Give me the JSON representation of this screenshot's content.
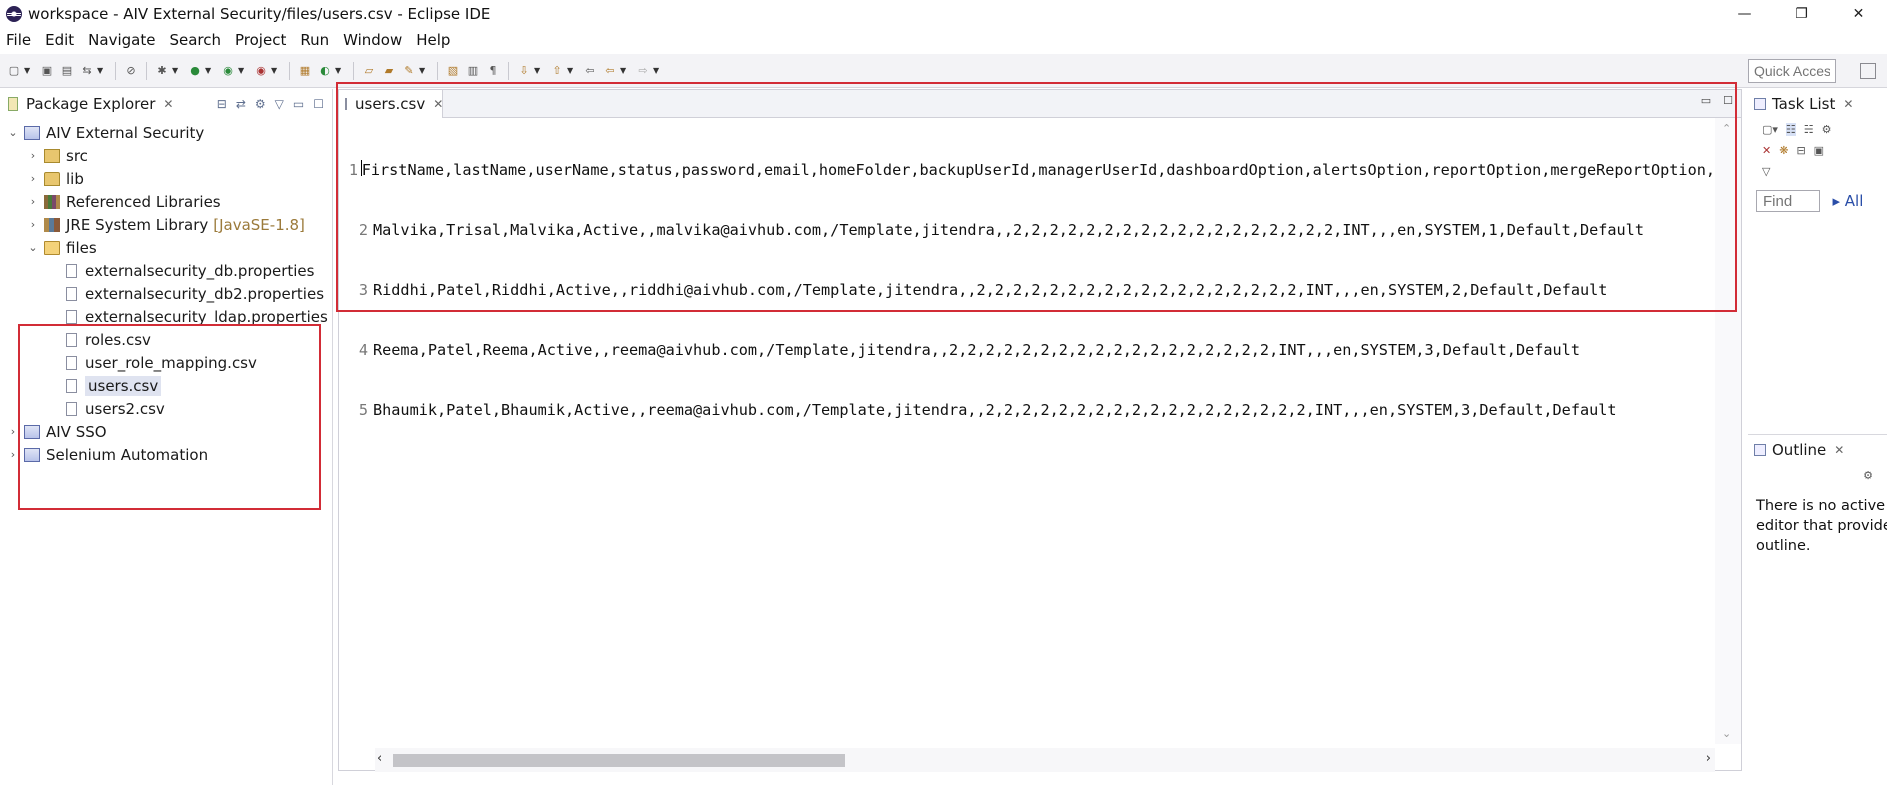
{
  "window": {
    "title": "workspace - AIV External Security/files/users.csv - Eclipse IDE",
    "minimize": "—",
    "restore": "❐",
    "close": "✕"
  },
  "menu": [
    "File",
    "Edit",
    "Navigate",
    "Search",
    "Project",
    "Run",
    "Window",
    "Help"
  ],
  "toolbar": {
    "quick_access_placeholder": "Quick Access"
  },
  "package_explorer": {
    "title": "Package Explorer",
    "tree": {
      "project": "AIV External Security",
      "src": "src",
      "lib": "lib",
      "ref_libs": "Referenced Libraries",
      "jre": "JRE System Library",
      "jre_version": "[JavaSE-1.8]",
      "files": "files",
      "file_items": [
        "externalsecurity_db.properties",
        "externalsecurity_db2.properties",
        "externalsecurity_ldap.properties",
        "roles.csv",
        "user_role_mapping.csv",
        "users.csv",
        "users2.csv"
      ],
      "project2": "AIV SSO",
      "project3": "Selenium Automation"
    }
  },
  "editor": {
    "tab_label": "users.csv",
    "lines": [
      {
        "num": "1",
        "text": "FirstName,lastName,userName,status,password,email,homeFolder,backupUserId,managerUserId,dashboardOption,alertsOption,reportOption,mergeReportOption,"
      },
      {
        "num": "2",
        "text": "Malvika,Trisal,Malvika,Active,,malvika@aivhub.com,/Template,jitendra,,2,2,2,2,2,2,2,2,2,2,2,2,2,2,2,2,2,2,INT,,,en,SYSTEM,1,Default,Default"
      },
      {
        "num": "3",
        "text": "Riddhi,Patel,Riddhi,Active,,riddhi@aivhub.com,/Template,jitendra,,2,2,2,2,2,2,2,2,2,2,2,2,2,2,2,2,2,2,INT,,,en,SYSTEM,2,Default,Default"
      },
      {
        "num": "4",
        "text": "Reema,Patel,Reema,Active,,reema@aivhub.com,/Template,jitendra,,2,2,2,2,2,2,2,2,2,2,2,2,2,2,2,2,2,2,INT,,,en,SYSTEM,3,Default,Default"
      },
      {
        "num": "5",
        "text": "Bhaumik,Patel,Bhaumik,Active,,reema@aivhub.com,/Template,jitendra,,2,2,2,2,2,2,2,2,2,2,2,2,2,2,2,2,2,2,INT,,,en,SYSTEM,3,Default,Default"
      }
    ]
  },
  "task_list": {
    "title": "Task List",
    "find_placeholder": "Find",
    "all_label": "All"
  },
  "outline": {
    "title": "Outline",
    "message_line1": "There is no active",
    "message_line2": "editor that provides",
    "message_line3": "outline."
  },
  "colors": {
    "highlight": "#d22c36",
    "link": "#2a4ea8"
  }
}
